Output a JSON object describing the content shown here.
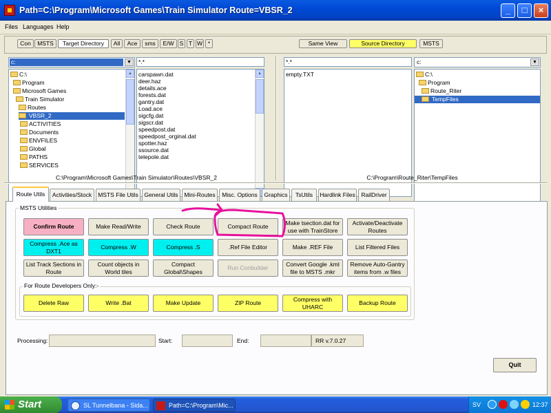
{
  "window": {
    "title": "Path=C:\\Program\\Microsoft Games\\Train Simulator  Route=VBSR_2",
    "minimize": "_",
    "maximize": "□",
    "close": "×"
  },
  "menu": [
    "Files",
    "Languages",
    "Help"
  ],
  "left_toolbar": [
    "Con",
    "MSTS",
    "Target Directory",
    "All",
    "Ace",
    "sms",
    "E/W",
    "S",
    "T",
    "W",
    "*"
  ],
  "right_toolbar": [
    "Same View",
    "Source Directory",
    "MSTS"
  ],
  "left_panel": {
    "drive": "c:",
    "filter": "*.*",
    "tree": [
      "C:\\",
      "Program",
      "Microsoft Games",
      "Train Simulator",
      "Routes",
      "VBSR_2",
      "ACTIVITIES",
      "Documents",
      "ENVFILES",
      "Global",
      "PATHS",
      "SERVICES"
    ],
    "files": [
      "carspawn.dat",
      "deer.haz",
      "details.ace",
      "forests.dat",
      "gantry.dat",
      "Load.ace",
      "sigcfg.dat",
      "sigscr.dat",
      "speedpost.dat",
      "speedpost_orginal.dat",
      "spotter.haz",
      "ssource.dat",
      "telepole.dat"
    ],
    "path": "C:\\Program\\Microsoft Games\\Train Simulator\\Routes\\VBSR_2"
  },
  "right_panel": {
    "filter": "*.*",
    "files": [
      "empty.TXT"
    ],
    "drive": "c:",
    "tree": [
      "C:\\",
      "Program",
      "Route_Riter",
      "TempFiles"
    ],
    "path": "C:\\Program\\Route_Riter\\TempFiles"
  },
  "tabs": [
    "Route Utils",
    "Activities/Stock",
    "MSTS File Utils",
    "General Utils",
    "Mini-Routes",
    "Misc. Options",
    "Graphics",
    "TsUtils",
    "Hardlink Files",
    "RailDriver"
  ],
  "msts_utilities": {
    "title": "MSTS Utilities",
    "row1": [
      "Confirm Route",
      "Make Read/Write",
      "Check Route",
      "Compact Route",
      "Make tsection.dat for use with TrainStore",
      "Activate/Deactivate Routes"
    ],
    "row2": [
      "Compress .Ace as DXT1",
      "Compress .W",
      "Compress .S",
      ".Ref File Editor",
      "Make .REF File",
      "List Filtered Files"
    ],
    "row3": [
      "List Track Sections in Route",
      "Count objects in World tiles",
      "Compact Global\\Shapes",
      "Run Conbuilder",
      "Convert Google .kml file to MSTS .mkr",
      "Remove Auto-Gantry items from .w files"
    ]
  },
  "route_developers": {
    "title": "For Route Developers Only:-",
    "buttons": [
      "Delete Raw",
      "Write .Bat",
      "Make Update",
      "ZIP Route",
      "Compress with UHARC",
      "Backup Route"
    ]
  },
  "status": {
    "processing_label": "Processing:",
    "start_label": "Start:",
    "end_label": "End:",
    "version": "RR v.7.0.27"
  },
  "quit_label": "Quit",
  "taskbar": {
    "start": "Start",
    "tasks": [
      "SL Tunnelbana - Sida...",
      "Path=C:\\Program\\Mic..."
    ],
    "lang": "SV",
    "clock": "12:37"
  },
  "colors": {
    "annotation": "#e8109b",
    "yellow_button": "#ffff66",
    "cyan_button": "#00f0f0",
    "pink_button": "#f7b0c3"
  }
}
